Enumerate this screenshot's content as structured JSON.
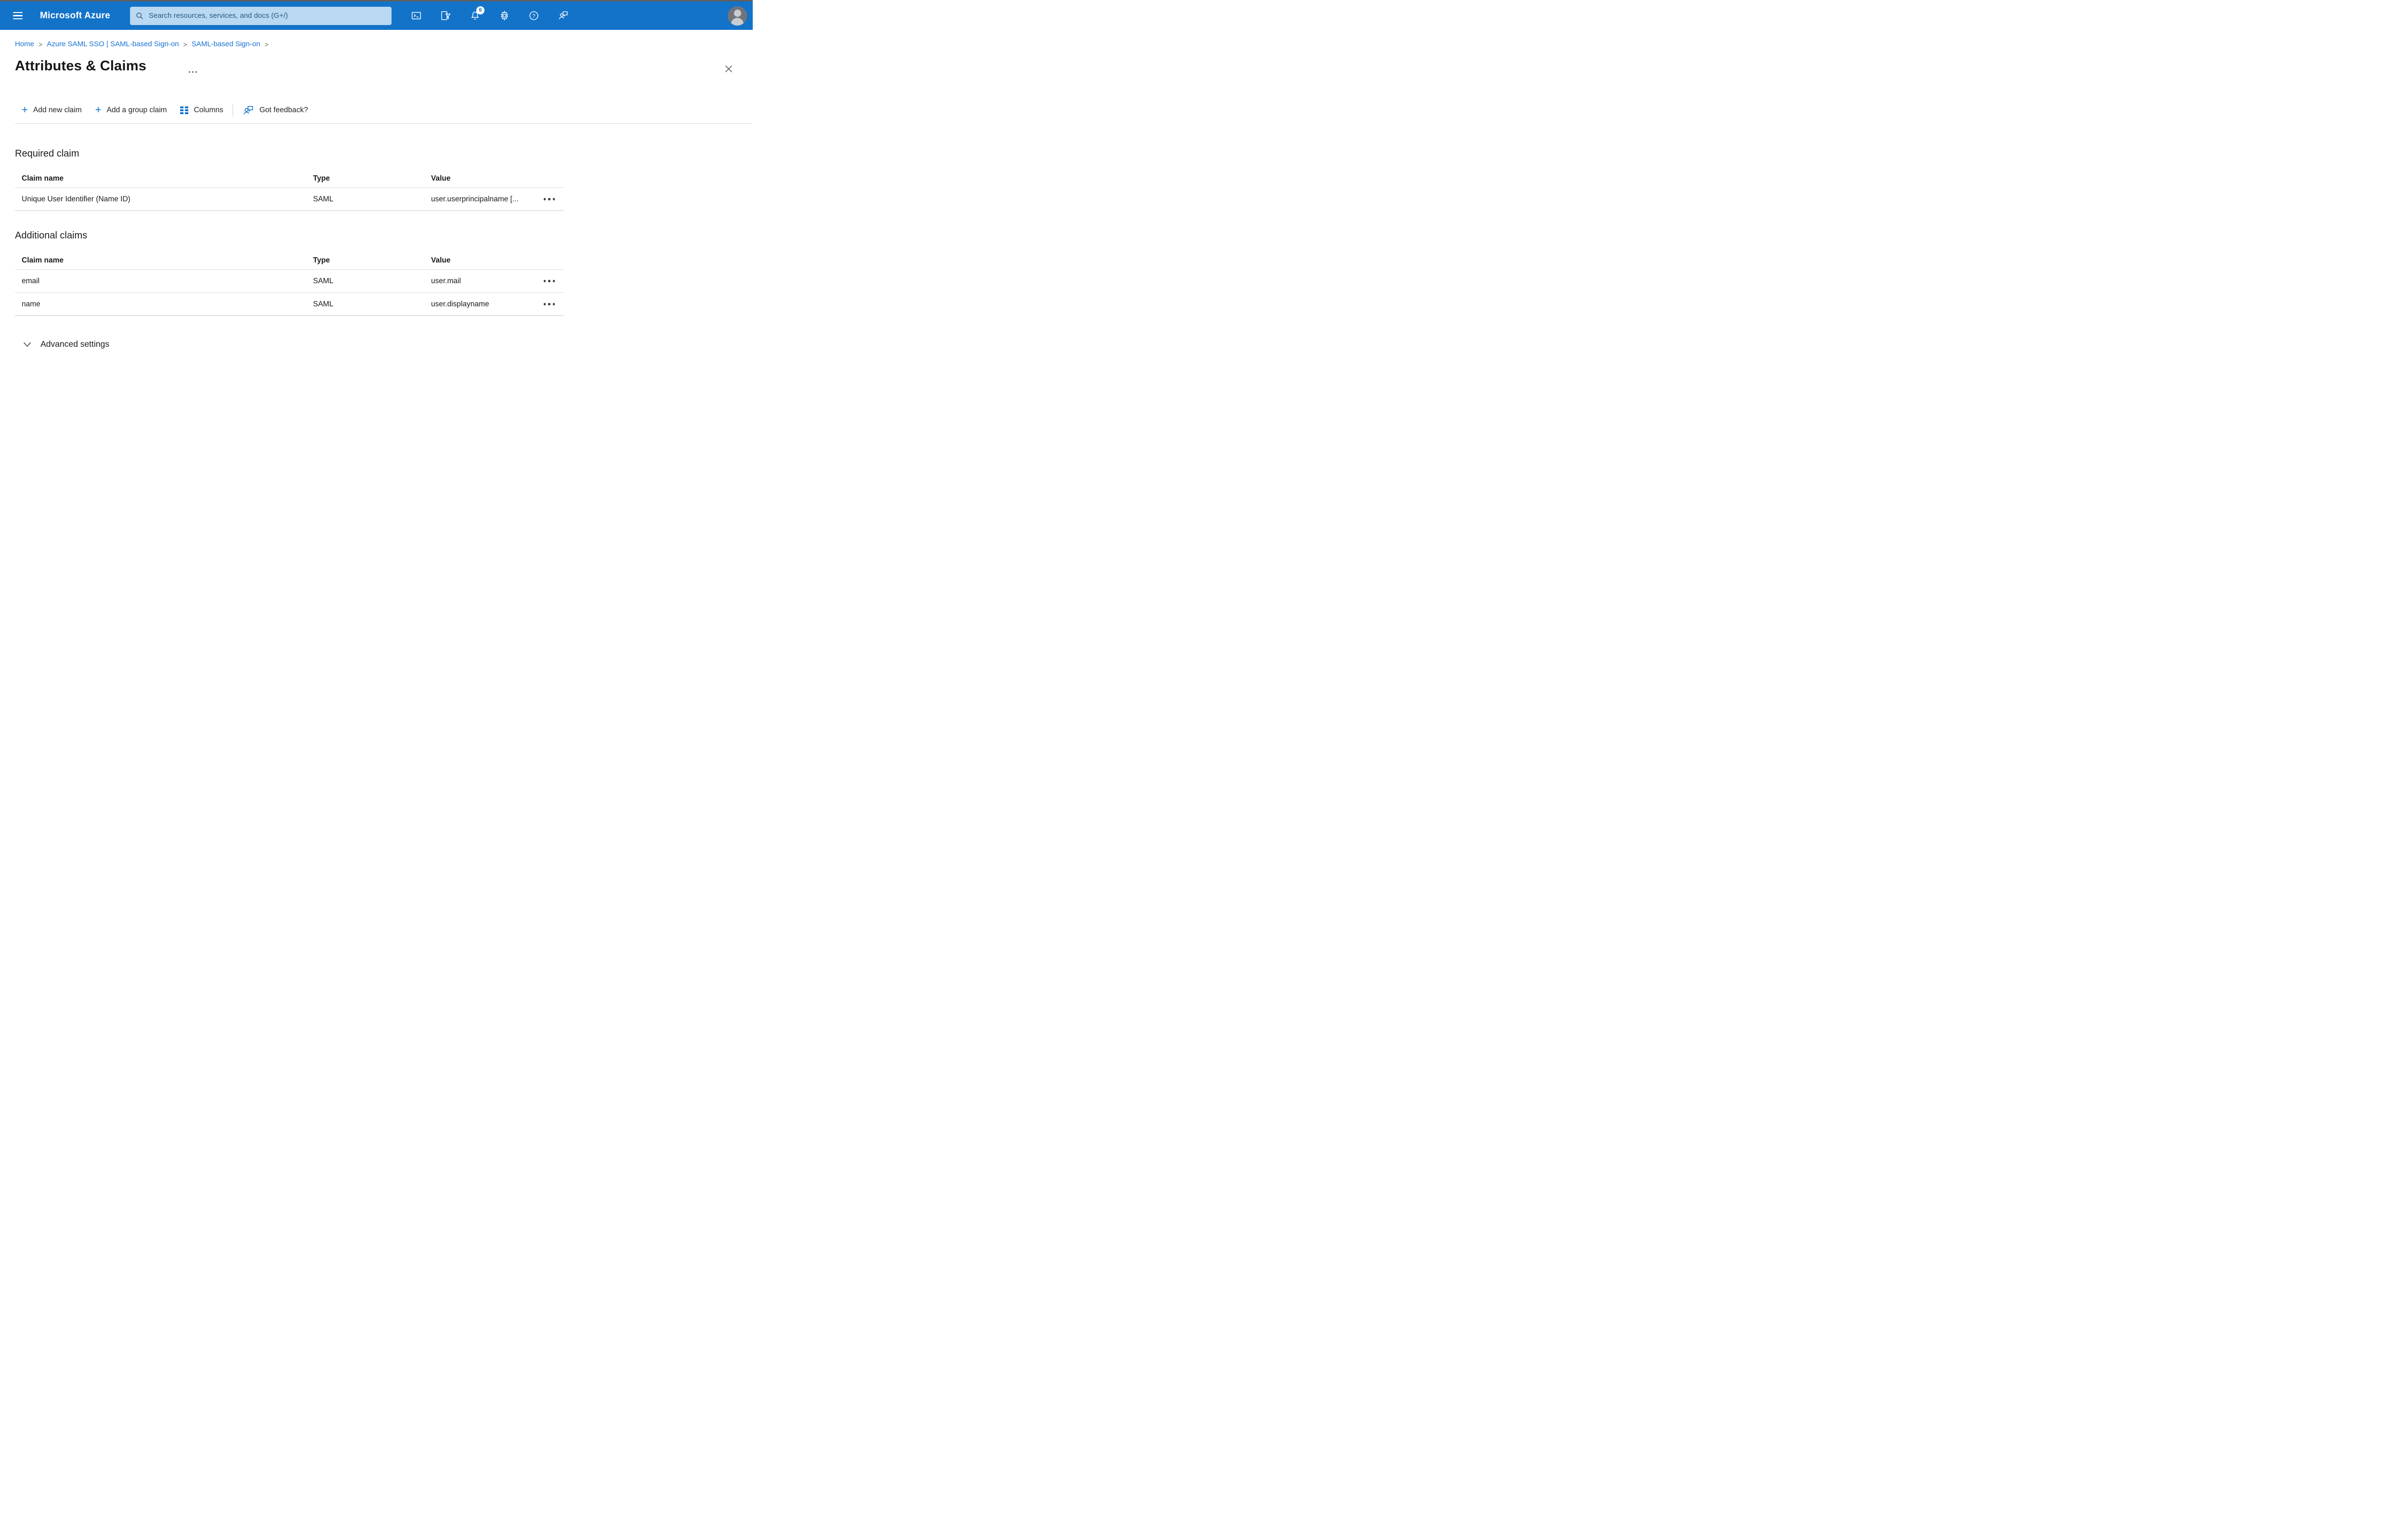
{
  "topbar": {
    "brand": "Microsoft Azure",
    "search_placeholder": "Search resources, services, and docs (G+/)",
    "notification_count": "6",
    "icons": [
      "cloud-shell-icon",
      "directory-filter-icon",
      "notifications-bell-icon",
      "settings-gear-icon",
      "help-icon",
      "feedback-icon",
      "avatar"
    ]
  },
  "breadcrumb": {
    "separator": ">",
    "items": [
      {
        "label": "Home"
      },
      {
        "label": "Azure SAML SSO | SAML-based Sign-on"
      },
      {
        "label": "SAML-based Sign-on"
      }
    ]
  },
  "page": {
    "title": "Attributes & Claims"
  },
  "toolbar": {
    "add_new_claim": "Add new claim",
    "add_group_claim": "Add a group claim",
    "columns": "Columns",
    "got_feedback": "Got feedback?"
  },
  "required_claim": {
    "heading": "Required claim",
    "columns": [
      "Claim name",
      "Type",
      "Value"
    ],
    "rows": [
      {
        "claim_name": "Unique User Identifier (Name ID)",
        "type": "SAML",
        "value": "user.userprincipalname [..."
      }
    ]
  },
  "additional_claims": {
    "heading": "Additional claims",
    "columns": [
      "Claim name",
      "Type",
      "Value"
    ],
    "rows": [
      {
        "claim_name": "email",
        "type": "SAML",
        "value": "user.mail"
      },
      {
        "claim_name": "name",
        "type": "SAML",
        "value": "user.displayname"
      }
    ]
  },
  "advanced": {
    "label": "Advanced settings"
  },
  "colors": {
    "topbar_blue": "#1373c9",
    "search_bg": "#b9d8f1",
    "search_text": "#275b84",
    "link_blue": "#1673d2",
    "accent_blue": "#1172cb",
    "text": "#1b1b1b",
    "divider": "#dcdcdc"
  }
}
